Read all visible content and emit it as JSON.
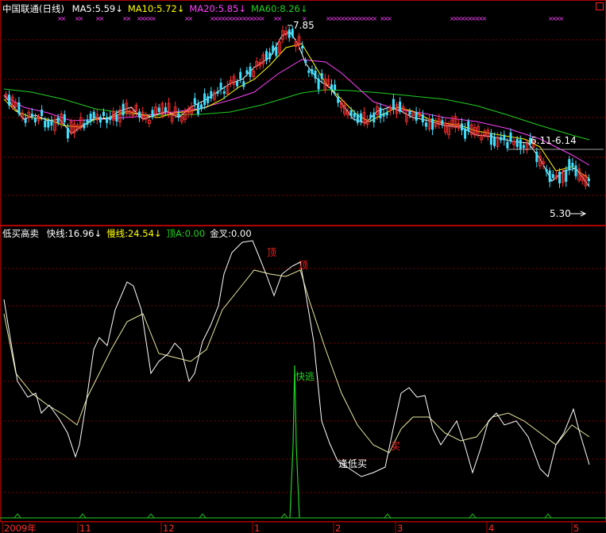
{
  "colors": {
    "background": "#000000",
    "frame": "#b00000",
    "grid": "#7a0000",
    "candle_up": "#ff3030",
    "candle_down": "#40e0ff",
    "ma5": "#ffffff",
    "ma10": "#ffff00",
    "ma20": "#ff40ff",
    "ma60": "#20d020",
    "fast_line": "#ffffff",
    "slow_line": "#e8e8a0",
    "top_signal": "#ff2020",
    "quick_escape": "#20d020",
    "buy_signal": "#ff2020",
    "gold_cross": "#ffff00"
  },
  "main_panel": {
    "title": "中国联通(日线)",
    "indicators": [
      {
        "label": "MA5:5.59",
        "arrow": "↓",
        "color": "#ffffff"
      },
      {
        "label": "MA10:5.72",
        "arrow": "↓",
        "color": "#ffff00"
      },
      {
        "label": "MA20:5.85",
        "arrow": "↓",
        "color": "#ff40ff"
      },
      {
        "label": "MA60:8.26",
        "arrow": "↓",
        "color": "#20d020"
      }
    ],
    "price_high_label": "7.85",
    "price_low_label": "5.30",
    "range_label": "6.11-6.14",
    "marker_glyph": "×"
  },
  "sub_panel": {
    "title": "低买高卖",
    "indicators": [
      {
        "label": "快线:16.96",
        "arrow": "↓",
        "color": "#ffffff"
      },
      {
        "label": "慢线:24.54",
        "arrow": "↓",
        "color": "#ffff00"
      },
      {
        "label": "顶A:0.00",
        "arrow": "",
        "color": "#20d020"
      },
      {
        "label": "金叉:0.00",
        "arrow": "",
        "color": "#ffffff"
      }
    ],
    "signals": {
      "top1": "顶",
      "top2": "顶",
      "quick_escape": "快逃",
      "low_buy": "逢低买",
      "buy": "买"
    }
  },
  "x_axis": {
    "labels": [
      "2009年",
      "11",
      "12",
      "1",
      "2",
      "3",
      "4",
      "5"
    ]
  }
}
